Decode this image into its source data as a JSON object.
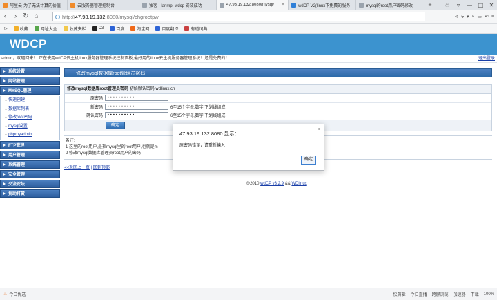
{
  "browser": {
    "tabs": [
      {
        "title": "阿里云-为了无法计算的价值",
        "color": "#f08b2b",
        "active": false
      },
      {
        "title": "云服务器管理控制台",
        "color": "#f08b2b",
        "active": false
      },
      {
        "title": "独客 - lanmp_wdcp 安装成功",
        "color": "#9aa3ad",
        "active": false
      },
      {
        "title": "47.93.19.132:8080/mysql/",
        "color": "#9aa3ad",
        "active": true
      },
      {
        "title": "wdCP V2(linux下免费的服务",
        "color": "#2f7fd8",
        "active": false
      },
      {
        "title": "mysql的root用户密码修改",
        "color": "#9aa3ad",
        "active": false
      }
    ],
    "new_tab": "+",
    "url_host": "47.93.19.132",
    "url_rest": ":8080/mysql/chgrootpw",
    "url_scheme": "http://",
    "bookmarks": [
      {
        "label": "收藏",
        "color": "#f2b02a"
      },
      {
        "label": "网址大全",
        "color": "#57a64b"
      },
      {
        "label": "收藏夹栏",
        "color": "#f2c94c"
      },
      {
        "label": "C3",
        "color": "#222222"
      },
      {
        "label": "百度",
        "color": "#2e64d6"
      },
      {
        "label": "淘宝网",
        "color": "#f06a1a"
      },
      {
        "label": "百度翻译",
        "color": "#2e64d6"
      },
      {
        "label": "有道词典",
        "color": "#c94040"
      }
    ]
  },
  "page": {
    "brand": "WDCP",
    "welcome": "admin，欢迎回来！ 正在使用wdCP云主机linux服务器管理系统控制面板,最好用的linux云主机服务器管理系统！还是免费的！",
    "logout": "退出登录",
    "sidebar": {
      "groups": [
        {
          "label": "系统设置"
        },
        {
          "label": "网站管理"
        },
        {
          "label": "MYSQL管理",
          "items": [
            "快速创建",
            "数据库列表",
            "修改root密码",
            "mysql设置",
            "phpmyadmin"
          ]
        },
        {
          "label": "FTP管理"
        },
        {
          "label": "用户管理"
        },
        {
          "label": "系统管理"
        },
        {
          "label": "安全管理"
        },
        {
          "label": "交流论坛"
        },
        {
          "label": "捐助打赏"
        }
      ]
    },
    "title": "修改mysql数据库root管理员密码",
    "form": {
      "heading_bold": "修改mysql数据库root管理员密码",
      "heading_note": "初始默认密码:wdlinux.cn",
      "fields": [
        {
          "label": "原密码",
          "value": "••••••••••",
          "hint": ""
        },
        {
          "label": "新密码",
          "value": "••••••••••",
          "hint": "6至15个字母,数字,下划线组成"
        },
        {
          "label": "确认密码",
          "value": "••••••••••",
          "hint": "6至15个字母,数字,下划线组成"
        }
      ],
      "submit": "确定"
    },
    "notes": {
      "label": "备注:",
      "line1": "1 这里的root用户,是指mysql里的root用户,也就是m",
      "line2": "2 修改mysql数据库管理员root用户的密码"
    },
    "back_link": "<<返回上一页",
    "back_sep": " | ",
    "top_link": "回到顶部",
    "footer": {
      "copy": "@2010 ",
      "product": "wdCP v3.2.9",
      "by": " && ",
      "company": "WDlinux"
    }
  },
  "dialog": {
    "title": "47.93.19.132:8080 显示：",
    "message": "原密码错误，请重新输入！",
    "ok": "确定",
    "close": "×"
  },
  "status": {
    "left": "今日优选",
    "items": [
      "快剪辑",
      "今日直播",
      "跨屏浏览",
      "加速器",
      "下载",
      "100%"
    ]
  }
}
